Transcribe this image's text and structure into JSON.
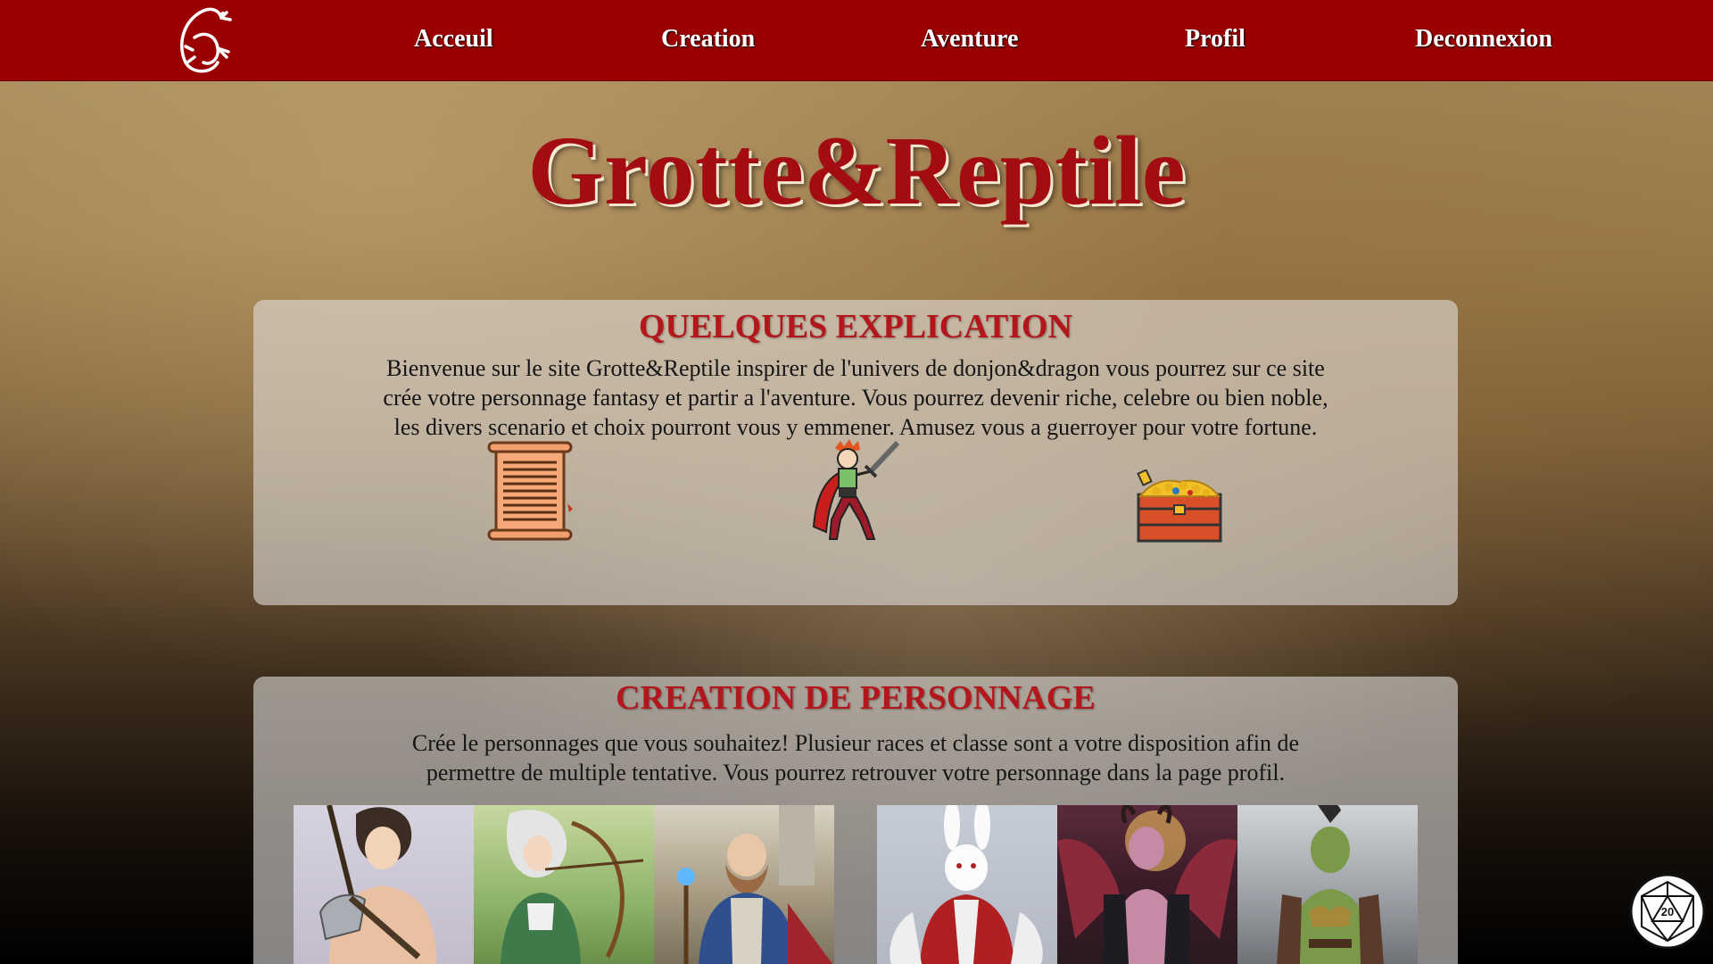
{
  "nav": {
    "items": [
      {
        "label": "Acceuil"
      },
      {
        "label": "Creation"
      },
      {
        "label": "Aventure"
      },
      {
        "label": "Profil"
      },
      {
        "label": "Deconnexion"
      }
    ]
  },
  "hero": {
    "title": "Grotte&Reptile"
  },
  "explanation": {
    "title": "QUELQUES EXPLICATION",
    "text": "Bienvenue sur le site Grotte&Reptile inspirer de l'univers de donjon&dragon vous pourrez sur ce site crée votre personnage fantasy et partir a l'aventure. Vous pourrez devenir riche, celebre ou bien noble, les divers scenario et choix pourront vous y emmener. Amusez vous a guerroyer pour votre fortune.",
    "icons": [
      "scroll-icon",
      "warrior-icon",
      "treasure-chest-icon"
    ]
  },
  "creation": {
    "title": "CREATION DE PERSONNAGE",
    "text": "Crée le personnages que vous souhaitez! Plusieur races et classe sont a votre disposition afin de permettre de multiple tentative. Vous pourrez retrouver votre personnage dans la page profil.",
    "characters": [
      "warrior-portrait",
      "elf-archer-portrait",
      "dwarf-mage-portrait",
      "rabbit-noble-portrait",
      "demon-portrait",
      "orc-portrait"
    ]
  },
  "colors": {
    "navbar": "#9b0000",
    "title": "#a30d12",
    "heading": "#b3171c"
  },
  "floating": {
    "icon": "d20-dice-icon"
  }
}
